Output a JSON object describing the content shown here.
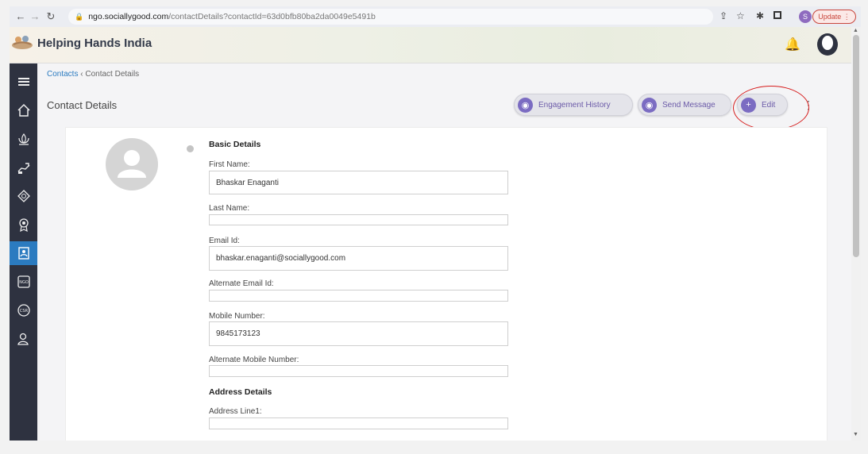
{
  "browser": {
    "url_host": "ngo.sociallygood.com",
    "url_path": "/contactDetails?contactId=63d0bfb80ba2da0049e5491b",
    "profile_initial": "S",
    "update_label": "Update"
  },
  "header": {
    "app_title": "Helping Hands India"
  },
  "breadcrumb": {
    "parent": "Contacts",
    "separator": "‹",
    "current": "Contact Details"
  },
  "page": {
    "title": "Contact Details"
  },
  "actions": {
    "engagement_history": "Engagement History",
    "send_message": "Send Message",
    "edit": "Edit"
  },
  "sections": {
    "basic": "Basic Details",
    "address": "Address Details"
  },
  "fields": {
    "first_name": {
      "label": "First Name:",
      "value": "Bhaskar Enaganti"
    },
    "last_name": {
      "label": "Last Name:",
      "value": ""
    },
    "email": {
      "label": "Email Id:",
      "value": "bhaskar.enaganti@sociallygood.com"
    },
    "alt_email": {
      "label": "Alternate Email Id:",
      "value": ""
    },
    "mobile": {
      "label": "Mobile Number:",
      "value": "9845173123"
    },
    "alt_mobile": {
      "label": "Alternate Mobile Number:",
      "value": ""
    },
    "address1": {
      "label": "Address Line1:",
      "value": ""
    }
  },
  "colors": {
    "sidebar": "#2e3240",
    "active_nav": "#2b7bc0",
    "accent_purple": "#7b6cc2",
    "annotation_red": "#d61c1c"
  },
  "icons": {
    "sidebar": [
      "menu-icon",
      "home-icon",
      "lotus-icon",
      "donate-hand-icon",
      "diamond-icon",
      "award-icon",
      "contacts-icon",
      "ngo-icon",
      "csr-icon",
      "users-icon"
    ]
  }
}
